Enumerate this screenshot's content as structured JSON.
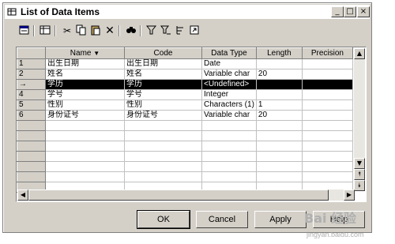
{
  "window": {
    "title": "List of Data Items",
    "minimize": "_",
    "maximize": "□",
    "close": "×"
  },
  "toolbar": {
    "icons": [
      "properties-icon",
      "customize-columns-icon",
      "cut-icon",
      "copy-icon",
      "paste-icon",
      "delete-icon",
      "find-icon",
      "filter-icon",
      "filter-clear-icon",
      "sort-icon",
      "export-icon"
    ]
  },
  "grid": {
    "columns": [
      "Name",
      "Code",
      "Data Type",
      "Length",
      "Precision"
    ],
    "rows": [
      {
        "num": "1",
        "name": "出生日期",
        "code": "出生日期",
        "type": "Date",
        "length": "",
        "precision": ""
      },
      {
        "num": "2",
        "name": "姓名",
        "code": "姓名",
        "type": "Variable char",
        "length": "20",
        "precision": ""
      },
      {
        "num": "→",
        "name": "学历",
        "code": "学历",
        "type": "<Undefined>",
        "length": "",
        "precision": ""
      },
      {
        "num": "4",
        "name": "学号",
        "code": "学号",
        "type": "Integer",
        "length": "",
        "precision": ""
      },
      {
        "num": "5",
        "name": "性别",
        "code": "性别",
        "type": "Characters (1)",
        "length": "1",
        "precision": ""
      },
      {
        "num": "6",
        "name": "身份证号",
        "code": "身份证号",
        "type": "Variable char",
        "length": "20",
        "precision": ""
      }
    ],
    "selected_row": 2
  },
  "buttons": {
    "ok": "OK",
    "cancel": "Cancel",
    "apply": "Apply",
    "help": "Help"
  },
  "watermark": {
    "main": "Bai 经验",
    "sub": "jingyan.baidu.com"
  }
}
